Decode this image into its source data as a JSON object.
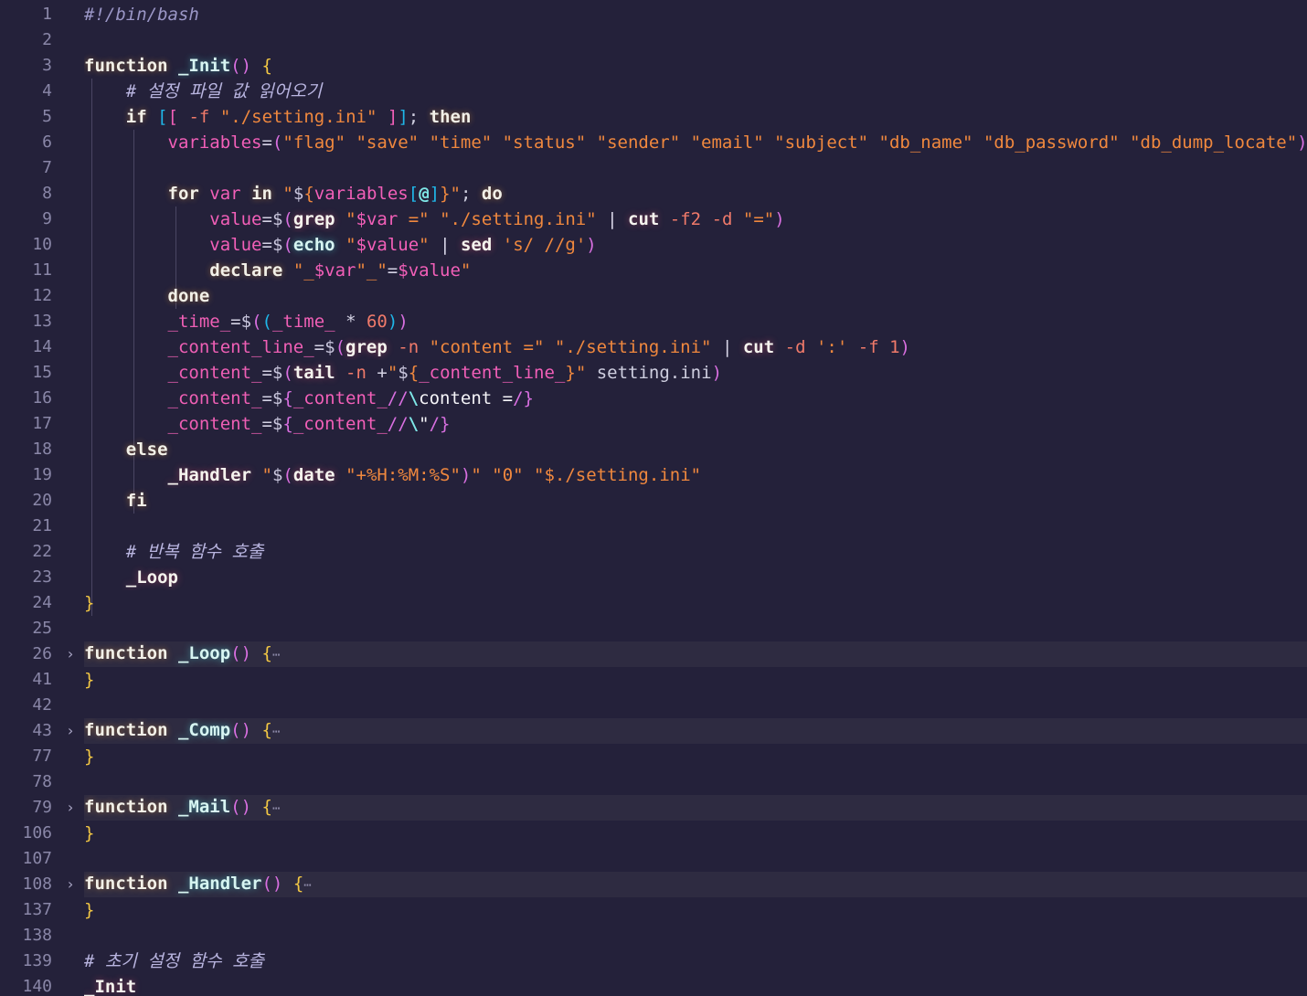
{
  "editor": {
    "language": "bash",
    "theme_background": "#24213a",
    "folded_line_background": "#2e2b41",
    "gutter_color": "#8a87a8",
    "fold_chevron": "›",
    "fold_ellipsis": "⋯"
  },
  "lines": [
    {
      "num": "1",
      "text": "#!/bin/bash"
    },
    {
      "num": "2",
      "text": ""
    },
    {
      "num": "3",
      "text": "function _Init() {"
    },
    {
      "num": "4",
      "text": "    # 설정 파일 값 읽어오기"
    },
    {
      "num": "5",
      "text": "    if [[ -f \"./setting.ini\" ]]; then"
    },
    {
      "num": "6",
      "text": "        variables=(\"flag\" \"save\" \"time\" \"status\" \"sender\" \"email\" \"subject\" \"db_name\" \"db_password\" \"db_dump_locate\")"
    },
    {
      "num": "7",
      "text": ""
    },
    {
      "num": "8",
      "text": "        for var in \"${variables[@]}\"; do"
    },
    {
      "num": "9",
      "text": "            value=$(grep \"$var =\" \"./setting.ini\" | cut -f2 -d \"=\")"
    },
    {
      "num": "10",
      "text": "            value=$(echo \"$value\" | sed 's/ //g')"
    },
    {
      "num": "11",
      "text": "            declare \"_$var\"_\"=$value\""
    },
    {
      "num": "12",
      "text": "        done"
    },
    {
      "num": "13",
      "text": "        _time_=$((_time_ * 60))"
    },
    {
      "num": "14",
      "text": "        _content_line_=$(grep -n \"content =\" \"./setting.ini\" | cut -d ':' -f 1)"
    },
    {
      "num": "15",
      "text": "        _content_=$(tail -n +\"${_content_line_}\" setting.ini)"
    },
    {
      "num": "16",
      "text": "        _content_=${_content_//\\content =/}"
    },
    {
      "num": "17",
      "text": "        _content_=${_content_//\\\"/}"
    },
    {
      "num": "18",
      "text": "    else"
    },
    {
      "num": "19",
      "text": "        _Handler \"$(date \"+%H:%M:%S\")\" \"0\" \"$./setting.ini\""
    },
    {
      "num": "20",
      "text": "    fi"
    },
    {
      "num": "21",
      "text": ""
    },
    {
      "num": "22",
      "text": "    # 반복 함수 호출"
    },
    {
      "num": "23",
      "text": "    _Loop"
    },
    {
      "num": "24",
      "text": "}"
    },
    {
      "num": "25",
      "text": ""
    },
    {
      "num": "26",
      "text": "function _Loop() {⋯",
      "folded": true
    },
    {
      "num": "41",
      "text": "}"
    },
    {
      "num": "42",
      "text": ""
    },
    {
      "num": "43",
      "text": "function _Comp() {⋯",
      "folded": true
    },
    {
      "num": "77",
      "text": "}"
    },
    {
      "num": "78",
      "text": ""
    },
    {
      "num": "79",
      "text": "function _Mail() {⋯",
      "folded": true
    },
    {
      "num": "106",
      "text": "}"
    },
    {
      "num": "107",
      "text": ""
    },
    {
      "num": "108",
      "text": "function _Handler() {⋯",
      "folded": true
    },
    {
      "num": "137",
      "text": "}"
    },
    {
      "num": "138",
      "text": ""
    },
    {
      "num": "139",
      "text": "# 초기 설정 함수 호출"
    },
    {
      "num": "140",
      "text": "_Init"
    }
  ],
  "comments": {
    "shebang": "#!/bin/bash",
    "read_config": "# 설정 파일 값 읽어오기",
    "loop_call": "# 반복 함수 호출",
    "init_call": "# 초기 설정 함수 호출"
  },
  "functions": [
    {
      "name": "_Init",
      "start": "3",
      "end": "24",
      "folded": false
    },
    {
      "name": "_Loop",
      "start": "26",
      "end": "41",
      "folded": true
    },
    {
      "name": "_Comp",
      "start": "43",
      "end": "77",
      "folded": true
    },
    {
      "name": "_Mail",
      "start": "79",
      "end": "106",
      "folded": true
    },
    {
      "name": "_Handler",
      "start": "108",
      "end": "137",
      "folded": true
    }
  ],
  "variables_array": [
    "flag",
    "save",
    "time",
    "status",
    "sender",
    "email",
    "subject",
    "db_name",
    "db_password",
    "db_dump_locate"
  ],
  "config_file": "./setting.ini"
}
